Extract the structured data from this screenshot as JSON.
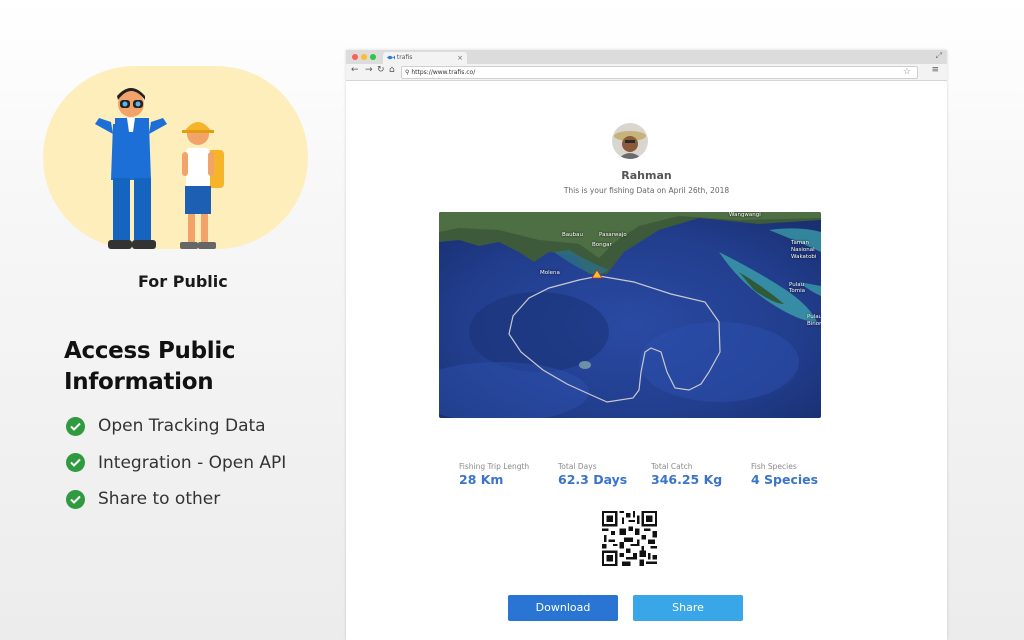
{
  "left_panel": {
    "caption": "For Public",
    "heading_line1": "Access Public",
    "heading_line2": "Information",
    "features": [
      {
        "label": "Open Tracking Data",
        "icon": "check-circle-icon"
      },
      {
        "label": "Integration - Open API",
        "icon": "check-circle-icon"
      },
      {
        "label": "Share to other",
        "icon": "check-circle-icon"
      }
    ],
    "colors": {
      "blob": "#fdeebc",
      "check": "#2f9a3f"
    }
  },
  "browser": {
    "tab_title": "trafis",
    "url": "https://www.trafis.co/",
    "profile": {
      "name": "Rahman",
      "subtitle": "This is your fishing Data on April 26th, 2018"
    },
    "map": {
      "labels": [
        "Wangwangi",
        "Baubau",
        "Pasarwajo",
        "Bongar",
        "Molena",
        "Taman Nasional Wakatobi",
        "Pulau Tomia",
        "Pulau Binongko"
      ]
    },
    "stats": [
      {
        "label": "Fishing Trip Length",
        "value": "28 Km"
      },
      {
        "label": "Total Days",
        "value": "62.3 Days"
      },
      {
        "label": "Total Catch",
        "value": "346.25 Kg"
      },
      {
        "label": "Fish Species",
        "value": "4 Species"
      }
    ],
    "buttons": {
      "download": "Download",
      "share": "Share"
    },
    "colors": {
      "download": "#2a75d3",
      "share": "#3aa6ea",
      "stat_value": "#3b74c9"
    }
  }
}
